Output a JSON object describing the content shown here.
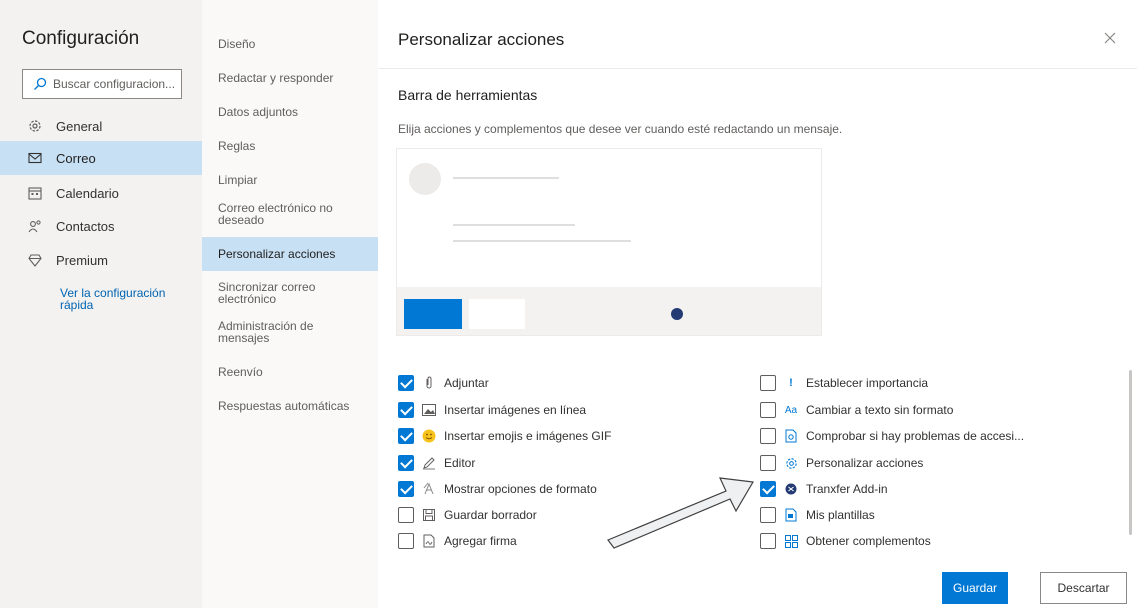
{
  "settings": {
    "title": "Configuración",
    "search_placeholder": "Buscar configuracion...",
    "nav": [
      {
        "label": "General",
        "icon": "gear-icon"
      },
      {
        "label": "Correo",
        "icon": "mail-icon",
        "active": true
      },
      {
        "label": "Calendario",
        "icon": "calendar-icon"
      },
      {
        "label": "Contactos",
        "icon": "contacts-icon"
      },
      {
        "label": "Premium",
        "icon": "diamond-icon"
      }
    ],
    "quick_link": "Ver la configuración rápida"
  },
  "subnav": [
    "Diseño",
    "Redactar y responder",
    "Datos adjuntos",
    "Reglas",
    "Limpiar",
    "Correo electrónico no deseado",
    "Personalizar acciones",
    "Sincronizar correo electrónico",
    "Administración de mensajes",
    "Reenvío",
    "Respuestas automáticas"
  ],
  "panel": {
    "title": "Personalizar acciones",
    "section_title": "Barra de herramientas",
    "section_desc": "Elija acciones y complementos que desee ver cuando esté redactando un mensaje."
  },
  "options_left": [
    {
      "label": "Adjuntar",
      "checked": true,
      "icon": "paperclip-icon"
    },
    {
      "label": "Insertar imágenes en línea",
      "checked": true,
      "icon": "image-icon"
    },
    {
      "label": "Insertar emojis e imágenes GIF",
      "checked": true,
      "icon": "emoji-icon"
    },
    {
      "label": "Editor",
      "checked": true,
      "icon": "pen-icon"
    },
    {
      "label": "Mostrar opciones de formato",
      "checked": true,
      "icon": "format-icon"
    },
    {
      "label": "Guardar borrador",
      "checked": false,
      "icon": "save-icon"
    },
    {
      "label": "Agregar firma",
      "checked": false,
      "icon": "signature-icon"
    }
  ],
  "options_right": [
    {
      "label": "Establecer importancia",
      "checked": false,
      "icon": "exclamation-icon"
    },
    {
      "label": "Cambiar a texto sin formato",
      "checked": false,
      "icon": "plain-text-icon"
    },
    {
      "label": "Comprobar si hay problemas de accesi...",
      "checked": false,
      "icon": "accessibility-icon"
    },
    {
      "label": "Personalizar acciones",
      "checked": false,
      "icon": "gear-icon"
    },
    {
      "label": "Tranxfer Add-in",
      "checked": true,
      "icon": "tranxfer-icon"
    },
    {
      "label": "Mis plantillas",
      "checked": false,
      "icon": "templates-icon"
    },
    {
      "label": "Obtener complementos",
      "checked": false,
      "icon": "apps-icon"
    }
  ],
  "footer": {
    "save_label": "Guardar",
    "discard_label": "Descartar"
  },
  "colors": {
    "accent": "#0078d4",
    "selected_bg": "#c7e0f4",
    "link": "#0063b1",
    "tranxfer": "#243a73"
  }
}
